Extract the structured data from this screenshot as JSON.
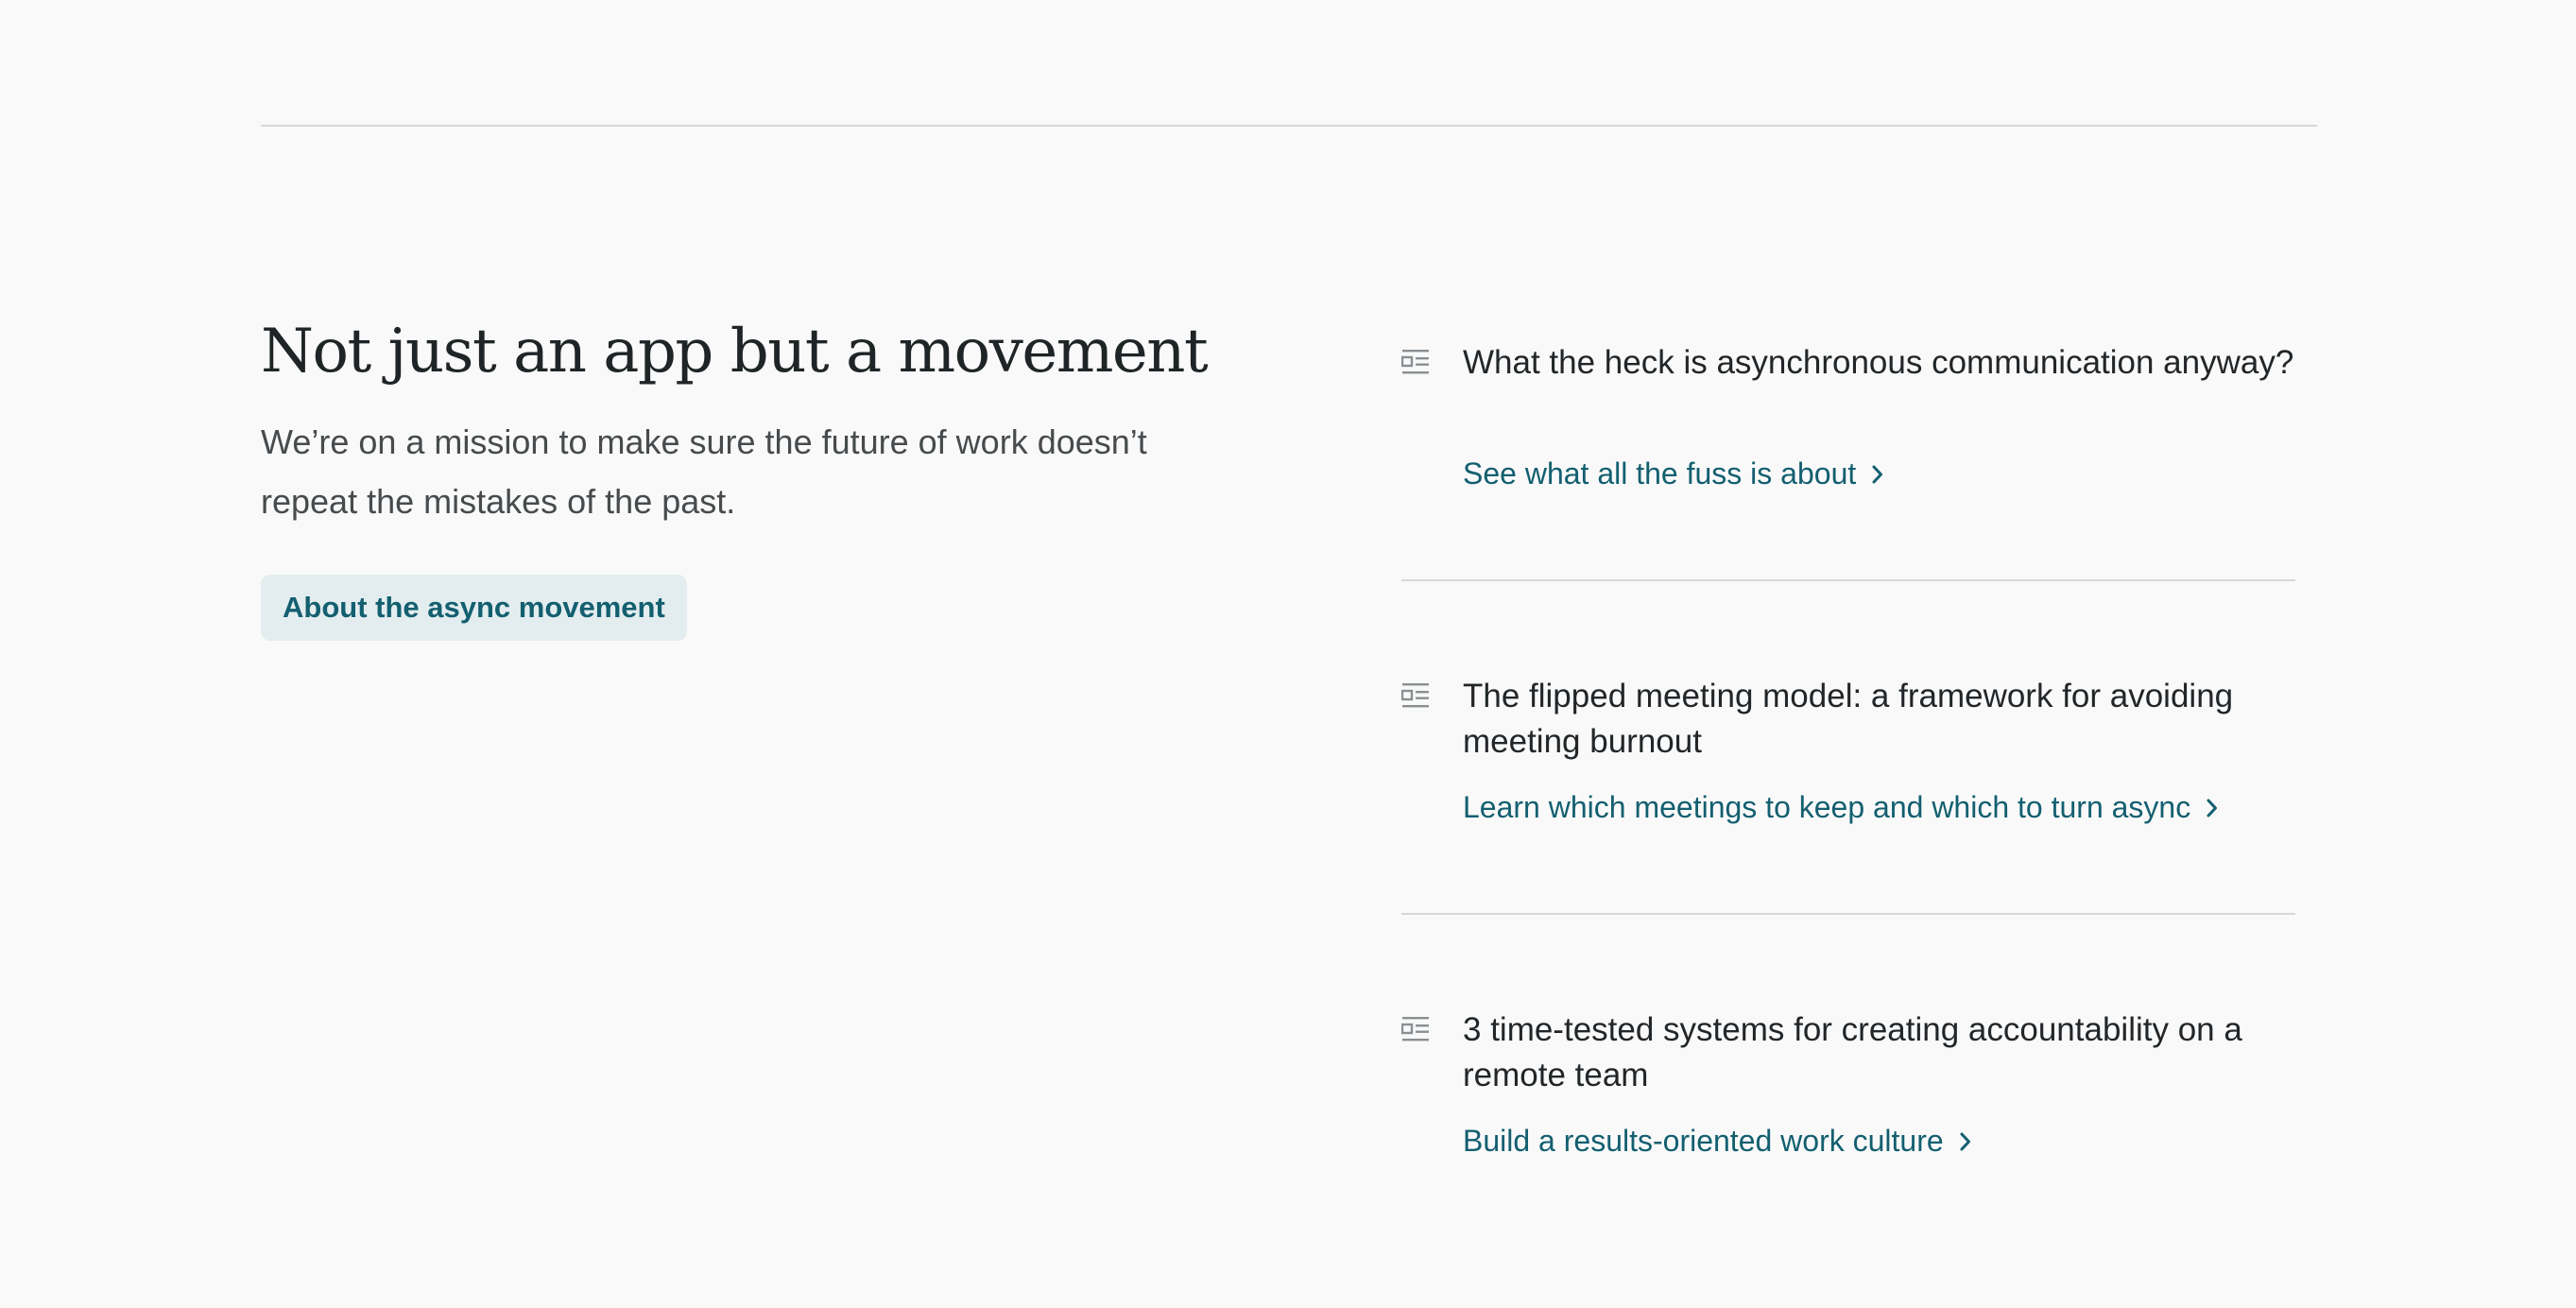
{
  "hero": {
    "title": "Not just an app but a movement",
    "subtitle": "We’re on a mission to make sure the future of work doesn’t repeat the mistakes of the past.",
    "button_label": "About the async movement"
  },
  "articles": [
    {
      "icon": "article-icon",
      "title": "What the heck is asynchronous communication anyway?",
      "link": "See what all the fuss is about"
    },
    {
      "icon": "article-icon",
      "title": "The flipped meeting model: a framework for avoiding meeting burnout",
      "link": "Learn which meetings to keep and which to turn async"
    },
    {
      "icon": "article-icon",
      "title": "3 time-tested systems for creating accountability on a remote team",
      "link": "Build a results-oriented work culture"
    }
  ],
  "colors": {
    "background": "#f9f9f9",
    "link": "#135f70",
    "button_background": "#e3edef",
    "divider": "#d7d7d7",
    "heading": "#1f2426"
  }
}
